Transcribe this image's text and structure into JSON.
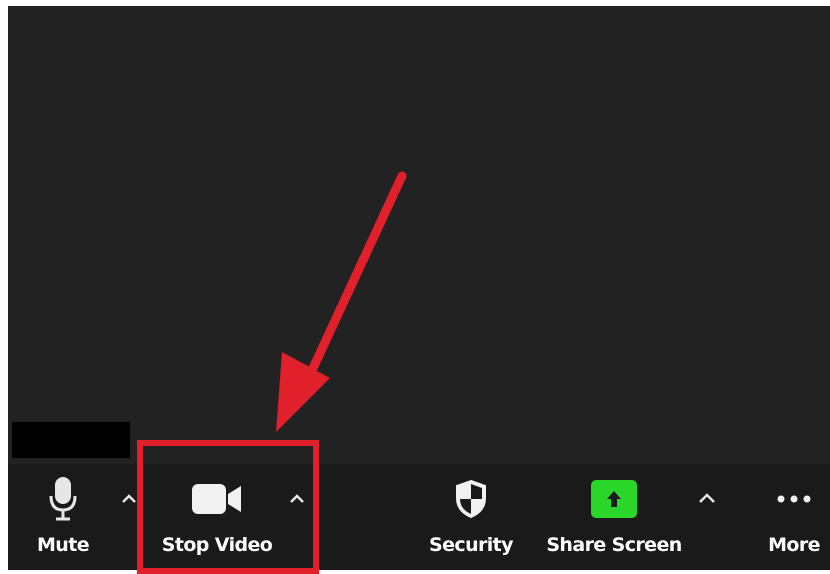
{
  "toolbar": {
    "mute_label": "Mute",
    "stop_video_label": "Stop Video",
    "security_label": "Security",
    "share_screen_label": "Share Screen",
    "more_label": "More"
  },
  "icons": {
    "mute": "microphone-icon",
    "video": "video-camera-icon",
    "security": "shield-icon",
    "share": "share-screen-icon",
    "more": "more-dots-icon",
    "caret": "chevron-up-icon"
  },
  "colors": {
    "video_background": "#222222",
    "toolbar_background": "#1a1a1a",
    "share_green": "#2bd62b",
    "annotation_red": "#e0202a"
  }
}
